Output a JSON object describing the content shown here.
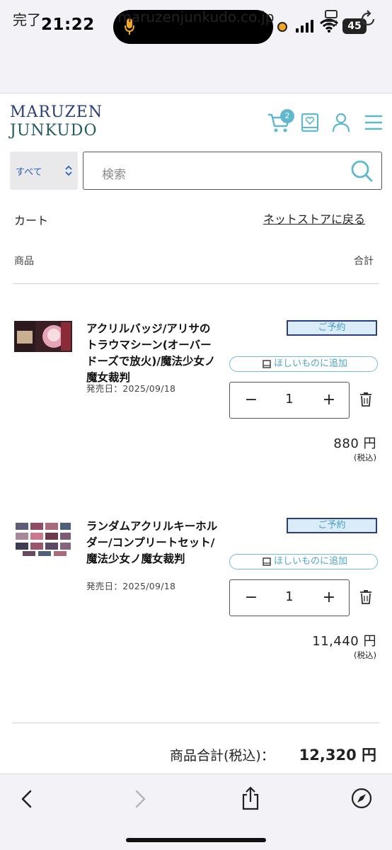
{
  "status_bar": {
    "time": "21:22",
    "battery": "45"
  },
  "browser": {
    "done_label": "完了",
    "url": "maruzenjunkudo.co.jp"
  },
  "site": {
    "logo_line1": "MARUZEN",
    "logo_line2": "JUNKUDO",
    "cart_count": "2"
  },
  "search": {
    "category": "すべて",
    "placeholder": "検索"
  },
  "cart": {
    "title": "カート",
    "back_link": "ネットストアに戻る",
    "col_product": "商品",
    "col_total": "合計",
    "items": [
      {
        "title": "アクリルバッジ/アリサのトラウマシーン(オーバードーズで放火)/魔法少女ノ魔女裁判",
        "release": "発売日：2025/09/18",
        "badge": "ご予約",
        "wishlist": "ほしいものに追加",
        "qty": "1",
        "price": "880 円",
        "tax": "(税込)"
      },
      {
        "title": "ランダムアクリルキーホルダー/コンプリートセット/魔法少女ノ魔女裁判",
        "release": "発売日：2025/09/18",
        "badge": "ご予約",
        "wishlist": "ほしいものに追加",
        "qty": "1",
        "price": "11,440 円",
        "tax": "(税込)"
      }
    ],
    "qty_minus": "−",
    "qty_plus": "+",
    "subtotal_label": "商品合計(税込)：",
    "subtotal_value": "12,320 円"
  },
  "colors": {
    "accent": "#5fb8cf",
    "logo_navy": "#2b3e7c",
    "badge_bg": "#d9ecf7"
  }
}
